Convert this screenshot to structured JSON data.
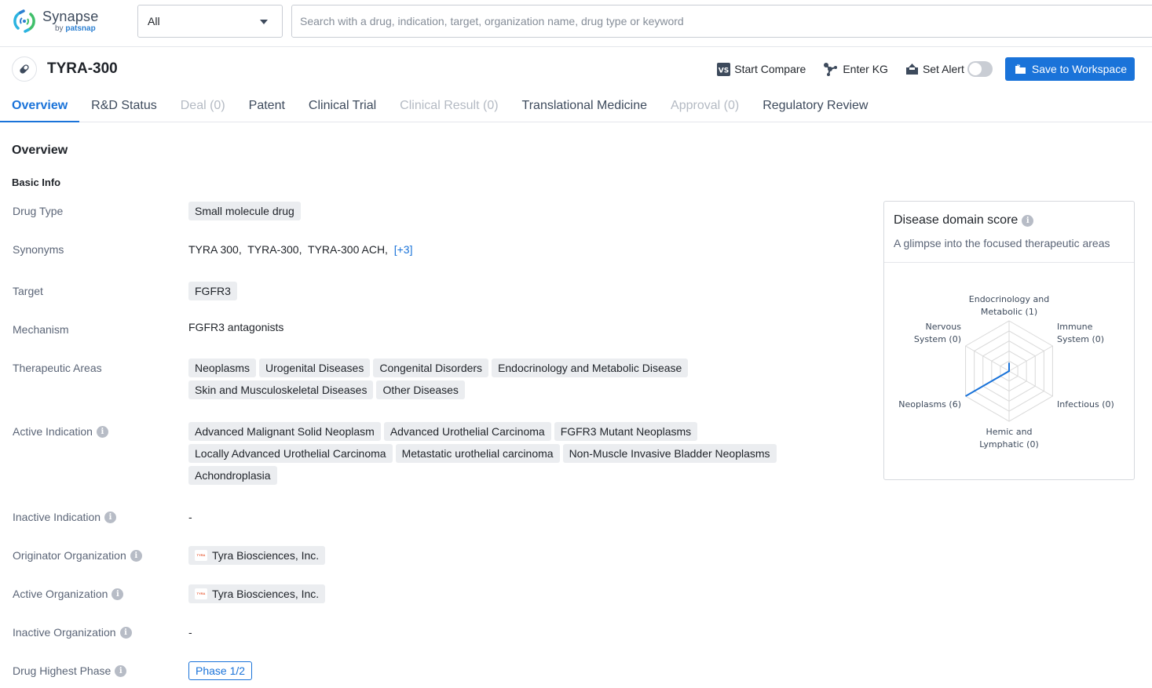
{
  "app": {
    "logo_title": "Synapse",
    "logo_by": "by",
    "logo_brand": "patsnap"
  },
  "search": {
    "scope_value": "All",
    "placeholder": "Search with a drug, indication, target, organization name, drug type or keyword",
    "value": ""
  },
  "header": {
    "drug_name": "TYRA-300",
    "actions": {
      "compare": "Start Compare",
      "kg": "Enter KG",
      "alert": "Set Alert",
      "alert_enabled": false,
      "save": "Save to Workspace"
    }
  },
  "tabs": [
    {
      "label": "Overview",
      "state": "active"
    },
    {
      "label": "R&D Status",
      "state": "normal"
    },
    {
      "label": "Deal (0)",
      "state": "disabled"
    },
    {
      "label": "Patent",
      "state": "normal"
    },
    {
      "label": "Clinical Trial",
      "state": "normal"
    },
    {
      "label": "Clinical Result (0)",
      "state": "disabled"
    },
    {
      "label": "Translational Medicine",
      "state": "normal"
    },
    {
      "label": "Approval (0)",
      "state": "disabled"
    },
    {
      "label": "Regulatory Review",
      "state": "normal"
    }
  ],
  "overview": {
    "section_title": "Overview",
    "basic_info_title": "Basic Info",
    "fields": {
      "drug_type": {
        "label": "Drug Type",
        "tags": [
          "Small molecule drug"
        ]
      },
      "synonyms": {
        "label": "Synonyms",
        "values": [
          "TYRA 300,",
          "TYRA-300,",
          "TYRA-300 ACH,"
        ],
        "more": "[+3]"
      },
      "target": {
        "label": "Target",
        "tags": [
          "FGFR3"
        ]
      },
      "mechanism": {
        "label": "Mechanism",
        "value": "FGFR3 antagonists"
      },
      "therapeutic_areas": {
        "label": "Therapeutic Areas",
        "tags": [
          "Neoplasms",
          "Urogenital Diseases",
          "Congenital Disorders",
          "Endocrinology and Metabolic Disease",
          "Skin and Musculoskeletal Diseases",
          "Other Diseases"
        ]
      },
      "active_indication": {
        "label": "Active Indication",
        "tags": [
          "Advanced Malignant Solid Neoplasm",
          "Advanced Urothelial Carcinoma",
          "FGFR3 Mutant Neoplasms",
          "Locally Advanced Urothelial Carcinoma",
          "Metastatic urothelial carcinoma",
          "Non-Muscle Invasive Bladder Neoplasms",
          "Achondroplasia"
        ]
      },
      "inactive_indication": {
        "label": "Inactive Indication",
        "value": "-"
      },
      "originator_org": {
        "label": "Originator Organization",
        "value": "Tyra Biosciences, Inc.",
        "logo_text": "TYRA"
      },
      "active_org": {
        "label": "Active Organization",
        "value": "Tyra Biosciences, Inc.",
        "logo_text": "TYRA"
      },
      "inactive_org": {
        "label": "Inactive Organization",
        "value": "-"
      },
      "highest_phase": {
        "label": "Drug Highest Phase",
        "value": "Phase 1/2"
      }
    }
  },
  "disease_domain": {
    "title": "Disease domain score",
    "description": "A glimpse into the focused therapeutic areas"
  },
  "chart_data": {
    "type": "radar",
    "title": "Disease domain score",
    "axes": [
      {
        "name": "Endocrinology and Metabolic",
        "label_lines": [
          "Endocrinology and",
          "Metabolic (1)"
        ],
        "value": 1
      },
      {
        "name": "Immune System",
        "label_lines": [
          "Immune",
          "System (0)"
        ],
        "value": 0
      },
      {
        "name": "Infectious",
        "label_lines": [
          "Infectious (0)"
        ],
        "value": 0
      },
      {
        "name": "Hemic and Lymphatic",
        "label_lines": [
          "Hemic and",
          "Lymphatic (0)"
        ],
        "value": 0
      },
      {
        "name": "Neoplasms",
        "label_lines": [
          "Neoplasms (6)"
        ],
        "value": 6
      },
      {
        "name": "Nervous System",
        "label_lines": [
          "Nervous",
          "System (0)"
        ],
        "value": 0
      }
    ],
    "max": 6,
    "rings": 5,
    "series_color": "#1a73d9",
    "grid_color": "#d9d9d9"
  },
  "colors": {
    "accent": "#1a73d9",
    "tag_bg": "#ebedf0",
    "label": "#5b6577",
    "disabled_tab": "#b4bac3"
  }
}
